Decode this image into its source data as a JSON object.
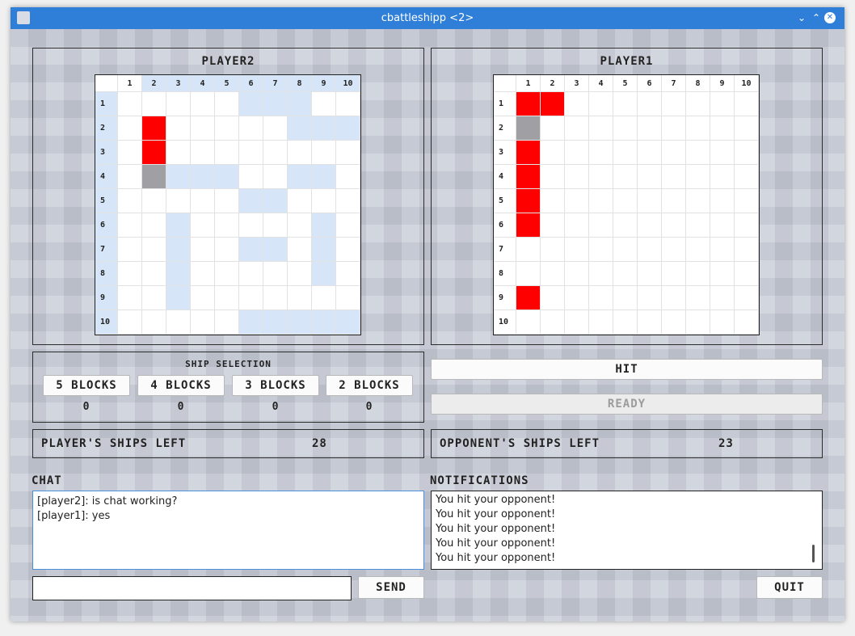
{
  "window": {
    "title": "cbattleshipp <2>"
  },
  "player2_board": {
    "title": "PLAYER2",
    "col_labels": [
      "1",
      "2",
      "3",
      "4",
      "5",
      "6",
      "7",
      "8",
      "9",
      "10"
    ],
    "row_labels": [
      "1",
      "2",
      "3",
      "4",
      "5",
      "6",
      "7",
      "8",
      "9",
      "10"
    ],
    "cells": [
      ".....hhh...",
      ".x.....hhh",
      ".x........",
      ".mhhh..hh.",
      ".....hh...",
      "..h.....h.",
      "..h..hh.h.",
      "..h.....h.",
      "..h.......",
      ".....hhhhh."
    ]
  },
  "player1_board": {
    "title": "PLAYER1",
    "col_labels": [
      "1",
      "2",
      "3",
      "4",
      "5",
      "6",
      "7",
      "8",
      "9",
      "10"
    ],
    "row_labels": [
      "1",
      "2",
      "3",
      "4",
      "5",
      "6",
      "7",
      "8",
      "9",
      "10"
    ],
    "cells": [
      "xx........",
      "m.........",
      "x.........",
      "x.........",
      "x.........",
      "x.........",
      "..........",
      "..........",
      "x.........",
      ".........."
    ]
  },
  "ship_selection": {
    "title": "SHIP SELECTION",
    "options": [
      {
        "label": "5 BLOCKS",
        "count": "0"
      },
      {
        "label": "4 BLOCKS",
        "count": "0"
      },
      {
        "label": "3 BLOCKS",
        "count": "0"
      },
      {
        "label": "2 BLOCKS",
        "count": "0"
      }
    ]
  },
  "actions": {
    "hit": "HIT",
    "ready": "READY"
  },
  "players_ships": {
    "label": "PLAYER'S SHIPS LEFT",
    "value": "28"
  },
  "opponents_ships": {
    "label": "OPPONENT'S SHIPS LEFT",
    "value": "23"
  },
  "chat": {
    "title": "CHAT",
    "messages": [
      "[player2]: is chat working?",
      "[player1]: yes"
    ],
    "input_value": "",
    "send": "SEND"
  },
  "notifications": {
    "title": "NOTIFICATIONS",
    "messages": [
      "You hit your opponent!",
      "You hit your opponent!",
      "You hit your opponent!",
      "You hit your opponent!",
      "You hit your opponent!"
    ]
  },
  "quit": "QUIT",
  "colors": {
    "hit": "#ff0000",
    "miss": "#a0a0a4",
    "highlight": "#d6e6f8",
    "titlebar": "#2f7fd8"
  }
}
